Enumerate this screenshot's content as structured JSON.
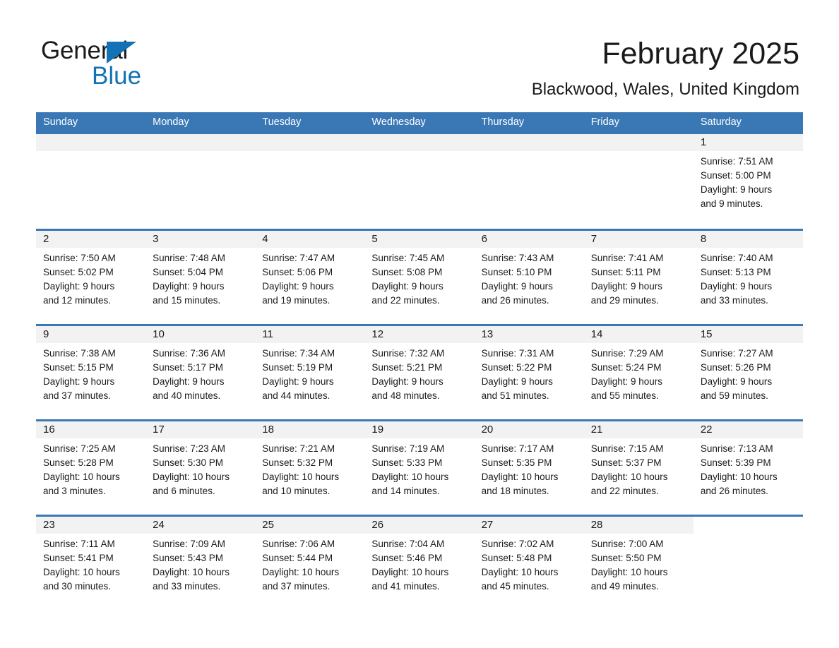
{
  "logo": {
    "word_one": "General",
    "word_two": "Blue",
    "triangle_color": "#1272b5",
    "word_two_color": "#1272b5"
  },
  "header": {
    "title": "February 2025",
    "subtitle": "Blackwood, Wales, United Kingdom"
  },
  "theme": {
    "header_blue": "#3a78b5",
    "row_divider_blue": "#3a78b5",
    "daynum_band_gray": "#f2f2f2",
    "text_color": "#1a1a1a",
    "page_background": "#ffffff"
  },
  "weekday_headers": [
    "Sunday",
    "Monday",
    "Tuesday",
    "Wednesday",
    "Thursday",
    "Friday",
    "Saturday"
  ],
  "labels": {
    "sunrise_prefix": "Sunrise:",
    "sunset_prefix": "Sunset:",
    "daylight_prefix": "Daylight:"
  },
  "weeks": [
    {
      "days": [
        {
          "empty": true
        },
        {
          "empty": true
        },
        {
          "empty": true
        },
        {
          "empty": true
        },
        {
          "empty": true
        },
        {
          "empty": true
        },
        {
          "empty": false,
          "daynum": "1",
          "sunrise": "Sunrise: 7:51 AM",
          "sunset": "Sunset: 5:00 PM",
          "daylight_line1": "Daylight: 9 hours",
          "daylight_line2": "and 9 minutes."
        }
      ]
    },
    {
      "days": [
        {
          "empty": false,
          "daynum": "2",
          "sunrise": "Sunrise: 7:50 AM",
          "sunset": "Sunset: 5:02 PM",
          "daylight_line1": "Daylight: 9 hours",
          "daylight_line2": "and 12 minutes."
        },
        {
          "empty": false,
          "daynum": "3",
          "sunrise": "Sunrise: 7:48 AM",
          "sunset": "Sunset: 5:04 PM",
          "daylight_line1": "Daylight: 9 hours",
          "daylight_line2": "and 15 minutes."
        },
        {
          "empty": false,
          "daynum": "4",
          "sunrise": "Sunrise: 7:47 AM",
          "sunset": "Sunset: 5:06 PM",
          "daylight_line1": "Daylight: 9 hours",
          "daylight_line2": "and 19 minutes."
        },
        {
          "empty": false,
          "daynum": "5",
          "sunrise": "Sunrise: 7:45 AM",
          "sunset": "Sunset: 5:08 PM",
          "daylight_line1": "Daylight: 9 hours",
          "daylight_line2": "and 22 minutes."
        },
        {
          "empty": false,
          "daynum": "6",
          "sunrise": "Sunrise: 7:43 AM",
          "sunset": "Sunset: 5:10 PM",
          "daylight_line1": "Daylight: 9 hours",
          "daylight_line2": "and 26 minutes."
        },
        {
          "empty": false,
          "daynum": "7",
          "sunrise": "Sunrise: 7:41 AM",
          "sunset": "Sunset: 5:11 PM",
          "daylight_line1": "Daylight: 9 hours",
          "daylight_line2": "and 29 minutes."
        },
        {
          "empty": false,
          "daynum": "8",
          "sunrise": "Sunrise: 7:40 AM",
          "sunset": "Sunset: 5:13 PM",
          "daylight_line1": "Daylight: 9 hours",
          "daylight_line2": "and 33 minutes."
        }
      ]
    },
    {
      "days": [
        {
          "empty": false,
          "daynum": "9",
          "sunrise": "Sunrise: 7:38 AM",
          "sunset": "Sunset: 5:15 PM",
          "daylight_line1": "Daylight: 9 hours",
          "daylight_line2": "and 37 minutes."
        },
        {
          "empty": false,
          "daynum": "10",
          "sunrise": "Sunrise: 7:36 AM",
          "sunset": "Sunset: 5:17 PM",
          "daylight_line1": "Daylight: 9 hours",
          "daylight_line2": "and 40 minutes."
        },
        {
          "empty": false,
          "daynum": "11",
          "sunrise": "Sunrise: 7:34 AM",
          "sunset": "Sunset: 5:19 PM",
          "daylight_line1": "Daylight: 9 hours",
          "daylight_line2": "and 44 minutes."
        },
        {
          "empty": false,
          "daynum": "12",
          "sunrise": "Sunrise: 7:32 AM",
          "sunset": "Sunset: 5:21 PM",
          "daylight_line1": "Daylight: 9 hours",
          "daylight_line2": "and 48 minutes."
        },
        {
          "empty": false,
          "daynum": "13",
          "sunrise": "Sunrise: 7:31 AM",
          "sunset": "Sunset: 5:22 PM",
          "daylight_line1": "Daylight: 9 hours",
          "daylight_line2": "and 51 minutes."
        },
        {
          "empty": false,
          "daynum": "14",
          "sunrise": "Sunrise: 7:29 AM",
          "sunset": "Sunset: 5:24 PM",
          "daylight_line1": "Daylight: 9 hours",
          "daylight_line2": "and 55 minutes."
        },
        {
          "empty": false,
          "daynum": "15",
          "sunrise": "Sunrise: 7:27 AM",
          "sunset": "Sunset: 5:26 PM",
          "daylight_line1": "Daylight: 9 hours",
          "daylight_line2": "and 59 minutes."
        }
      ]
    },
    {
      "days": [
        {
          "empty": false,
          "daynum": "16",
          "sunrise": "Sunrise: 7:25 AM",
          "sunset": "Sunset: 5:28 PM",
          "daylight_line1": "Daylight: 10 hours",
          "daylight_line2": "and 3 minutes."
        },
        {
          "empty": false,
          "daynum": "17",
          "sunrise": "Sunrise: 7:23 AM",
          "sunset": "Sunset: 5:30 PM",
          "daylight_line1": "Daylight: 10 hours",
          "daylight_line2": "and 6 minutes."
        },
        {
          "empty": false,
          "daynum": "18",
          "sunrise": "Sunrise: 7:21 AM",
          "sunset": "Sunset: 5:32 PM",
          "daylight_line1": "Daylight: 10 hours",
          "daylight_line2": "and 10 minutes."
        },
        {
          "empty": false,
          "daynum": "19",
          "sunrise": "Sunrise: 7:19 AM",
          "sunset": "Sunset: 5:33 PM",
          "daylight_line1": "Daylight: 10 hours",
          "daylight_line2": "and 14 minutes."
        },
        {
          "empty": false,
          "daynum": "20",
          "sunrise": "Sunrise: 7:17 AM",
          "sunset": "Sunset: 5:35 PM",
          "daylight_line1": "Daylight: 10 hours",
          "daylight_line2": "and 18 minutes."
        },
        {
          "empty": false,
          "daynum": "21",
          "sunrise": "Sunrise: 7:15 AM",
          "sunset": "Sunset: 5:37 PM",
          "daylight_line1": "Daylight: 10 hours",
          "daylight_line2": "and 22 minutes."
        },
        {
          "empty": false,
          "daynum": "22",
          "sunrise": "Sunrise: 7:13 AM",
          "sunset": "Sunset: 5:39 PM",
          "daylight_line1": "Daylight: 10 hours",
          "daylight_line2": "and 26 minutes."
        }
      ]
    },
    {
      "days": [
        {
          "empty": false,
          "daynum": "23",
          "sunrise": "Sunrise: 7:11 AM",
          "sunset": "Sunset: 5:41 PM",
          "daylight_line1": "Daylight: 10 hours",
          "daylight_line2": "and 30 minutes."
        },
        {
          "empty": false,
          "daynum": "24",
          "sunrise": "Sunrise: 7:09 AM",
          "sunset": "Sunset: 5:43 PM",
          "daylight_line1": "Daylight: 10 hours",
          "daylight_line2": "and 33 minutes."
        },
        {
          "empty": false,
          "daynum": "25",
          "sunrise": "Sunrise: 7:06 AM",
          "sunset": "Sunset: 5:44 PM",
          "daylight_line1": "Daylight: 10 hours",
          "daylight_line2": "and 37 minutes."
        },
        {
          "empty": false,
          "daynum": "26",
          "sunrise": "Sunrise: 7:04 AM",
          "sunset": "Sunset: 5:46 PM",
          "daylight_line1": "Daylight: 10 hours",
          "daylight_line2": "and 41 minutes."
        },
        {
          "empty": false,
          "daynum": "27",
          "sunrise": "Sunrise: 7:02 AM",
          "sunset": "Sunset: 5:48 PM",
          "daylight_line1": "Daylight: 10 hours",
          "daylight_line2": "and 45 minutes."
        },
        {
          "empty": false,
          "daynum": "28",
          "sunrise": "Sunrise: 7:00 AM",
          "sunset": "Sunset: 5:50 PM",
          "daylight_line1": "Daylight: 10 hours",
          "daylight_line2": "and 49 minutes."
        },
        {
          "empty": true,
          "no_band": true
        }
      ]
    }
  ]
}
